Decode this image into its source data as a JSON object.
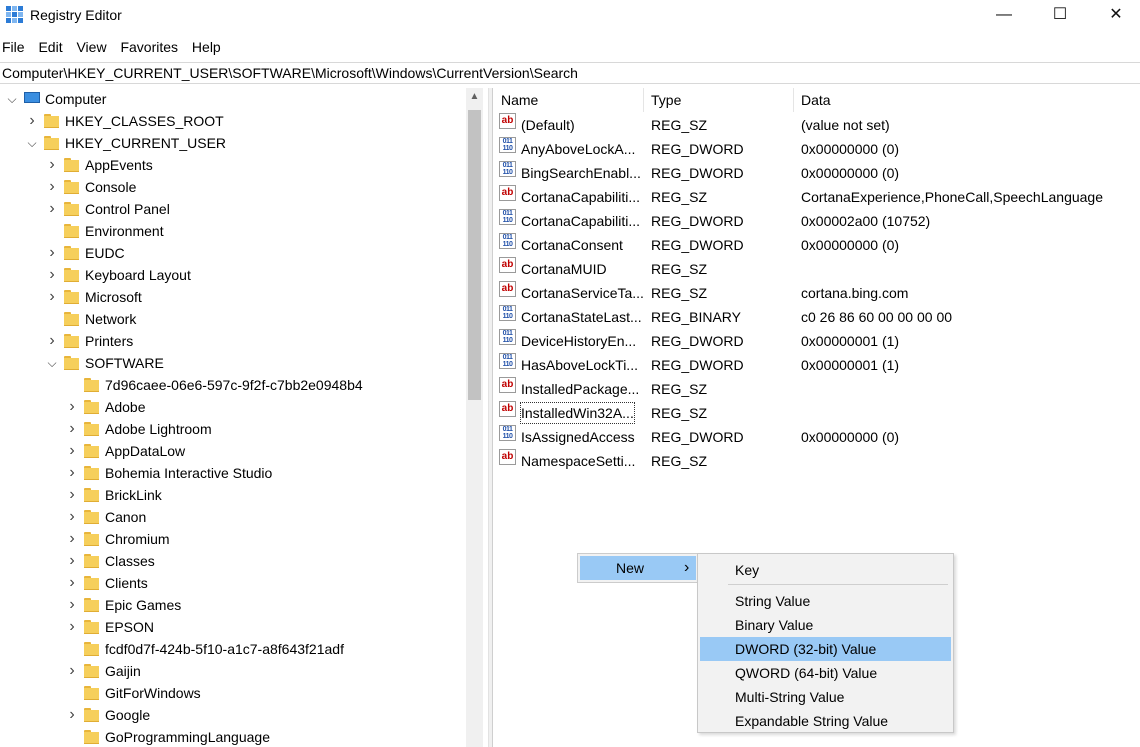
{
  "window": {
    "title": "Registry Editor",
    "minimize_glyph": "—",
    "maximize_glyph": "☐",
    "close_glyph": "✕"
  },
  "menu": [
    "File",
    "Edit",
    "View",
    "Favorites",
    "Help"
  ],
  "address": "Computer\\HKEY_CURRENT_USER\\SOFTWARE\\Microsoft\\Windows\\CurrentVersion\\Search",
  "tree": [
    {
      "label": "Computer",
      "expanded": true,
      "depth": 0,
      "icon": "computer-icon"
    },
    {
      "label": "HKEY_CLASSES_ROOT",
      "expanded": false,
      "depth": 1
    },
    {
      "label": "HKEY_CURRENT_USER",
      "expanded": true,
      "depth": 1
    },
    {
      "label": "AppEvents",
      "expanded": false,
      "depth": 2
    },
    {
      "label": "Console",
      "expanded": false,
      "depth": 2
    },
    {
      "label": "Control Panel",
      "expanded": false,
      "depth": 2
    },
    {
      "label": "Environment",
      "expanded": null,
      "depth": 2
    },
    {
      "label": "EUDC",
      "expanded": false,
      "depth": 2
    },
    {
      "label": "Keyboard Layout",
      "expanded": false,
      "depth": 2
    },
    {
      "label": "Microsoft",
      "expanded": false,
      "depth": 2
    },
    {
      "label": "Network",
      "expanded": null,
      "depth": 2
    },
    {
      "label": "Printers",
      "expanded": false,
      "depth": 2
    },
    {
      "label": "SOFTWARE",
      "expanded": true,
      "depth": 2
    },
    {
      "label": "7d96caee-06e6-597c-9f2f-c7bb2e0948b4",
      "expanded": null,
      "depth": 3
    },
    {
      "label": "Adobe",
      "expanded": false,
      "depth": 3
    },
    {
      "label": "Adobe Lightroom",
      "expanded": false,
      "depth": 3
    },
    {
      "label": "AppDataLow",
      "expanded": false,
      "depth": 3
    },
    {
      "label": "Bohemia Interactive Studio",
      "expanded": false,
      "depth": 3
    },
    {
      "label": "BrickLink",
      "expanded": false,
      "depth": 3
    },
    {
      "label": "Canon",
      "expanded": false,
      "depth": 3
    },
    {
      "label": "Chromium",
      "expanded": false,
      "depth": 3
    },
    {
      "label": "Classes",
      "expanded": false,
      "depth": 3
    },
    {
      "label": "Clients",
      "expanded": false,
      "depth": 3
    },
    {
      "label": "Epic Games",
      "expanded": false,
      "depth": 3
    },
    {
      "label": "EPSON",
      "expanded": false,
      "depth": 3
    },
    {
      "label": "fcdf0d7f-424b-5f10-a1c7-a8f643f21adf",
      "expanded": null,
      "depth": 3
    },
    {
      "label": "Gaijin",
      "expanded": false,
      "depth": 3
    },
    {
      "label": "GitForWindows",
      "expanded": null,
      "depth": 3
    },
    {
      "label": "Google",
      "expanded": false,
      "depth": 3
    },
    {
      "label": "GoProgrammingLanguage",
      "expanded": null,
      "depth": 3
    }
  ],
  "columns": {
    "name": "Name",
    "type": "Type",
    "data": "Data"
  },
  "values": [
    {
      "name": "(Default)",
      "type": "REG_SZ",
      "data": "(value not set)",
      "icon": "ab"
    },
    {
      "name": "AnyAboveLockA...",
      "type": "REG_DWORD",
      "data": "0x00000000 (0)",
      "icon": "bin"
    },
    {
      "name": "BingSearchEnabl...",
      "type": "REG_DWORD",
      "data": "0x00000000 (0)",
      "icon": "bin"
    },
    {
      "name": "CortanaCapabiliti...",
      "type": "REG_SZ",
      "data": "CortanaExperience,PhoneCall,SpeechLanguage",
      "icon": "ab"
    },
    {
      "name": "CortanaCapabiliti...",
      "type": "REG_DWORD",
      "data": "0x00002a00 (10752)",
      "icon": "bin"
    },
    {
      "name": "CortanaConsent",
      "type": "REG_DWORD",
      "data": "0x00000000 (0)",
      "icon": "bin"
    },
    {
      "name": "CortanaMUID",
      "type": "REG_SZ",
      "data": "",
      "icon": "ab"
    },
    {
      "name": "CortanaServiceTa...",
      "type": "REG_SZ",
      "data": "cortana.bing.com",
      "icon": "ab"
    },
    {
      "name": "CortanaStateLast...",
      "type": "REG_BINARY",
      "data": "c0 26 86 60 00 00 00 00",
      "icon": "bin"
    },
    {
      "name": "DeviceHistoryEn...",
      "type": "REG_DWORD",
      "data": "0x00000001 (1)",
      "icon": "bin"
    },
    {
      "name": "HasAboveLockTi...",
      "type": "REG_DWORD",
      "data": "0x00000001 (1)",
      "icon": "bin"
    },
    {
      "name": "InstalledPackage...",
      "type": "REG_SZ",
      "data": "",
      "icon": "ab"
    },
    {
      "name": "InstalledWin32A...",
      "type": "REG_SZ",
      "data": "",
      "icon": "ab",
      "focused": true
    },
    {
      "name": "IsAssignedAccess",
      "type": "REG_DWORD",
      "data": "0x00000000 (0)",
      "icon": "bin"
    },
    {
      "name": "NamespaceSetti...",
      "type": "REG_SZ",
      "data": "",
      "icon": "ab"
    }
  ],
  "context_menu": {
    "new_label": "New",
    "arrow": "›"
  },
  "submenu": {
    "items": [
      "Key",
      "String Value",
      "Binary Value",
      "DWORD (32-bit) Value",
      "QWORD (64-bit) Value",
      "Multi-String Value",
      "Expandable String Value"
    ],
    "highlighted": "DWORD (32-bit) Value"
  }
}
